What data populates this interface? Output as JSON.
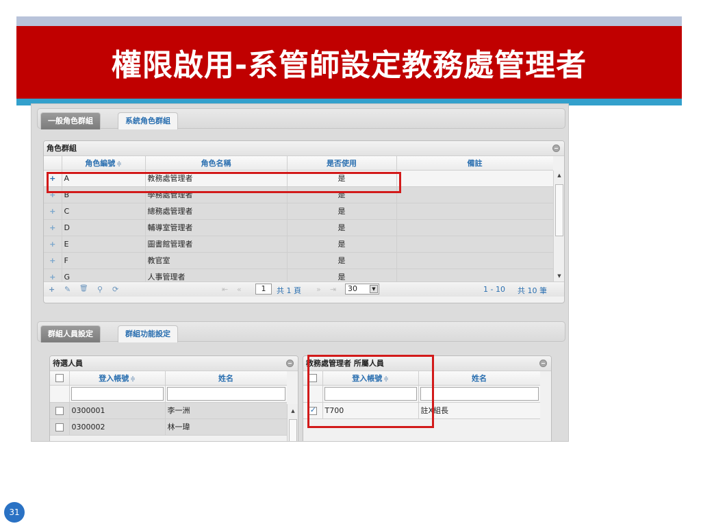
{
  "slide": {
    "title": "權限啟用-系管師設定教務處管理者",
    "page_number": "31"
  },
  "top_tabs": [
    {
      "label": "一般角色群組",
      "active": true
    },
    {
      "label": "系統角色群組",
      "active": false
    }
  ],
  "role_grid": {
    "caption": "角色群組",
    "columns": {
      "code": "角色編號",
      "name": "角色名稱",
      "enabled": "是否使用",
      "note": "備註"
    },
    "sort_indicator": "≑",
    "rows": [
      {
        "add": "+",
        "code": "A",
        "name": "教務處管理者",
        "enabled": "是",
        "note": ""
      },
      {
        "add": "+",
        "code": "B",
        "name": "學務處管理者",
        "enabled": "是",
        "note": ""
      },
      {
        "add": "+",
        "code": "C",
        "name": "總務處管理者",
        "enabled": "是",
        "note": ""
      },
      {
        "add": "+",
        "code": "D",
        "name": "輔導室管理者",
        "enabled": "是",
        "note": ""
      },
      {
        "add": "+",
        "code": "E",
        "name": "圖書館管理者",
        "enabled": "是",
        "note": ""
      },
      {
        "add": "+",
        "code": "F",
        "name": "教官室",
        "enabled": "是",
        "note": ""
      },
      {
        "add": "+",
        "code": "G",
        "name": "人事管理者",
        "enabled": "是",
        "note": ""
      }
    ],
    "pager": {
      "add": "+",
      "edit": "✎",
      "delete": "🗑",
      "search": "⚲",
      "refresh": "⟳",
      "first": "⇤",
      "prev": "«",
      "page_value": "1",
      "page_total": "共 1 頁",
      "next": "»",
      "last": "⇥",
      "rows_per_page": "30",
      "range": "1 - 10",
      "record_total": "共 10 筆"
    }
  },
  "bottom_tabs": [
    {
      "label": "群組人員設定",
      "active": true
    },
    {
      "label": "群組功能設定",
      "active": false
    }
  ],
  "candidates": {
    "caption": "待選人員",
    "columns": {
      "account": "登入帳號",
      "name": "姓名"
    },
    "rows": [
      {
        "account": "0300001",
        "name": "李一洲",
        "checked": false
      },
      {
        "account": "0300002",
        "name": "林一瑋",
        "checked": false
      }
    ]
  },
  "members": {
    "caption": "教務處管理者 所屬人員",
    "columns": {
      "account": "登入帳號",
      "name": "姓名"
    },
    "rows": [
      {
        "account": "T700",
        "name": "註X組長",
        "checked": true
      }
    ]
  },
  "colors": {
    "title_bar": "#c00000",
    "top_strip": "#b8c3da",
    "accent_line": "#33a0cc",
    "header_text": "#2a6fb0",
    "highlight_box": "#d21a1a"
  }
}
